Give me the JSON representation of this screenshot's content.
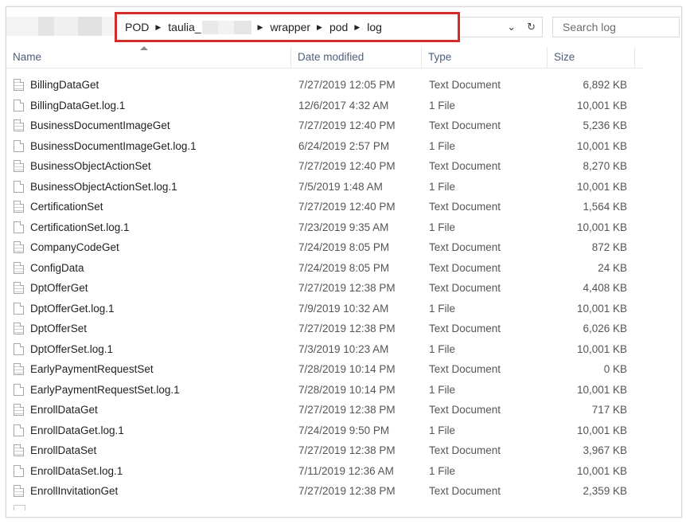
{
  "address": {
    "crumbs": [
      "POD",
      "taulia_",
      "wrapper",
      "pod",
      "log"
    ]
  },
  "search": {
    "placeholder": "Search log"
  },
  "columns": {
    "name": "Name",
    "date": "Date modified",
    "type": "Type",
    "size": "Size"
  },
  "icons": {
    "text_file": "text-document-icon",
    "generic_file": "file-icon",
    "dropdown": "chevron-down-icon",
    "refresh": "refresh-icon"
  },
  "files": [
    {
      "name": "BillingDataGet",
      "date": "7/27/2019 12:05 PM",
      "type": "Text Document",
      "size": "6,892 KB"
    },
    {
      "name": "BillingDataGet.log.1",
      "date": "12/6/2017 4:32 AM",
      "type": "1 File",
      "size": "10,001 KB"
    },
    {
      "name": "BusinessDocumentImageGet",
      "date": "7/27/2019 12:40 PM",
      "type": "Text Document",
      "size": "5,236 KB"
    },
    {
      "name": "BusinessDocumentImageGet.log.1",
      "date": "6/24/2019 2:57 PM",
      "type": "1 File",
      "size": "10,001 KB"
    },
    {
      "name": "BusinessObjectActionSet",
      "date": "7/27/2019 12:40 PM",
      "type": "Text Document",
      "size": "8,270 KB"
    },
    {
      "name": "BusinessObjectActionSet.log.1",
      "date": "7/5/2019 1:48 AM",
      "type": "1 File",
      "size": "10,001 KB"
    },
    {
      "name": "CertificationSet",
      "date": "7/27/2019 12:40 PM",
      "type": "Text Document",
      "size": "1,564 KB"
    },
    {
      "name": "CertificationSet.log.1",
      "date": "7/23/2019 9:35 AM",
      "type": "1 File",
      "size": "10,001 KB"
    },
    {
      "name": "CompanyCodeGet",
      "date": "7/24/2019 8:05 PM",
      "type": "Text Document",
      "size": "872 KB"
    },
    {
      "name": "ConfigData",
      "date": "7/24/2019 8:05 PM",
      "type": "Text Document",
      "size": "24 KB"
    },
    {
      "name": "DptOfferGet",
      "date": "7/27/2019 12:38 PM",
      "type": "Text Document",
      "size": "4,408 KB"
    },
    {
      "name": "DptOfferGet.log.1",
      "date": "7/9/2019 10:32 AM",
      "type": "1 File",
      "size": "10,001 KB"
    },
    {
      "name": "DptOfferSet",
      "date": "7/27/2019 12:38 PM",
      "type": "Text Document",
      "size": "6,026 KB"
    },
    {
      "name": "DptOfferSet.log.1",
      "date": "7/3/2019 10:23 AM",
      "type": "1 File",
      "size": "10,001 KB"
    },
    {
      "name": "EarlyPaymentRequestSet",
      "date": "7/28/2019 10:14 PM",
      "type": "Text Document",
      "size": "0 KB"
    },
    {
      "name": "EarlyPaymentRequestSet.log.1",
      "date": "7/28/2019 10:14 PM",
      "type": "1 File",
      "size": "10,001 KB"
    },
    {
      "name": "EnrollDataGet",
      "date": "7/27/2019 12:38 PM",
      "type": "Text Document",
      "size": "717 KB"
    },
    {
      "name": "EnrollDataGet.log.1",
      "date": "7/24/2019 9:50 PM",
      "type": "1 File",
      "size": "10,001 KB"
    },
    {
      "name": "EnrollDataSet",
      "date": "7/27/2019 12:38 PM",
      "type": "Text Document",
      "size": "3,967 KB"
    },
    {
      "name": "EnrollDataSet.log.1",
      "date": "7/11/2019 12:36 AM",
      "type": "1 File",
      "size": "10,001 KB"
    },
    {
      "name": "EnrollInvitationGet",
      "date": "7/27/2019 12:38 PM",
      "type": "Text Document",
      "size": "2,359 KB"
    }
  ]
}
